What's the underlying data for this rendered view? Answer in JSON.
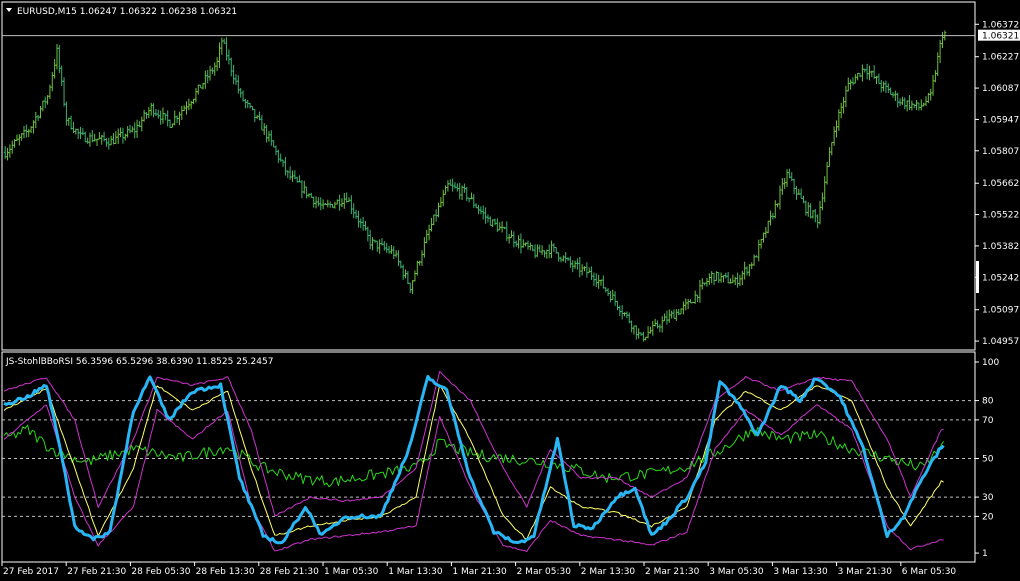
{
  "window": {
    "symbol_header": "EURUSD,M15  1.06247 1.06322 1.06238 1.06321",
    "indicator_header": "JS-StohlBBoRSI 56.3596 65.5296 38.6390 11.8525 25.2457"
  },
  "colors": {
    "background": "#000000",
    "axis": "#ffffff",
    "price_bars": "#3cb371",
    "price_bars_alt": "#6fbf3f",
    "rsi_line": "#2bd619",
    "main_line": "#29b6f6",
    "signal_line": "#ffff66",
    "band_lines": "#cc33cc",
    "level_lines": "#c0c0c0",
    "price_line": "#c0c0c0"
  },
  "chart_data": [
    {
      "type": "ohlc",
      "title": "EURUSD,M15",
      "ohlc_header": {
        "open": 1.06247,
        "high": 1.06322,
        "low": 1.06238,
        "close": 1.06321
      },
      "current_price_label": "1.06321",
      "ylim": [
        1.04935,
        1.064
      ],
      "y_ticks": [
        "1.06372",
        "1.06227",
        "1.06087",
        "1.05947",
        "1.05807",
        "1.05662",
        "1.05522",
        "1.05382",
        "1.05242",
        "1.05097",
        "1.04957"
      ],
      "x_ticks": [
        "27 Feb 2017",
        "27 Feb 21:30",
        "28 Feb 05:30",
        "28 Feb 13:30",
        "28 Feb 21:30",
        "1 Mar 05:30",
        "1 Mar 13:30",
        "1 Mar 21:30",
        "2 Mar 05:30",
        "2 Mar 13:30",
        "2 Mar 21:30",
        "3 Mar 05:30",
        "3 Mar 13:30",
        "3 Mar 21:30",
        "6 Mar 05:30"
      ],
      "close_anchors": [
        [
          0,
          1.058
        ],
        [
          10,
          1.059
        ],
        [
          18,
          1.0605
        ],
        [
          22,
          1.0625
        ],
        [
          26,
          1.0595
        ],
        [
          32,
          1.0587
        ],
        [
          45,
          1.0585
        ],
        [
          55,
          1.059
        ],
        [
          62,
          1.06
        ],
        [
          70,
          1.0593
        ],
        [
          80,
          1.0605
        ],
        [
          90,
          1.062
        ],
        [
          92,
          1.063
        ],
        [
          100,
          1.0605
        ],
        [
          110,
          1.059
        ],
        [
          120,
          1.057
        ],
        [
          135,
          1.0555
        ],
        [
          145,
          1.056
        ],
        [
          155,
          1.054
        ],
        [
          165,
          1.0535
        ],
        [
          172,
          1.052
        ],
        [
          180,
          1.0545
        ],
        [
          188,
          1.0565
        ],
        [
          195,
          1.0562
        ],
        [
          205,
          1.055
        ],
        [
          215,
          1.0542
        ],
        [
          225,
          1.0535
        ],
        [
          232,
          1.0537
        ],
        [
          240,
          1.053
        ],
        [
          250,
          1.0525
        ],
        [
          258,
          1.0515
        ],
        [
          265,
          1.0505
        ],
        [
          270,
          1.0497
        ],
        [
          280,
          1.0505
        ],
        [
          290,
          1.0512
        ],
        [
          300,
          1.0525
        ],
        [
          310,
          1.0522
        ],
        [
          318,
          1.0532
        ],
        [
          325,
          1.055
        ],
        [
          332,
          1.057
        ],
        [
          340,
          1.0555
        ],
        [
          345,
          1.055
        ],
        [
          352,
          1.059
        ],
        [
          358,
          1.061
        ],
        [
          365,
          1.0618
        ],
        [
          372,
          1.061
        ],
        [
          380,
          1.0603
        ],
        [
          388,
          1.06
        ],
        [
          393,
          1.0605
        ],
        [
          398,
          1.0633
        ]
      ]
    },
    {
      "type": "line",
      "title": "JS-StohlBBoRSI",
      "values_header": [
        56.3596,
        65.5296,
        38.639,
        11.8525,
        25.2457
      ],
      "ylim": [
        0,
        100
      ],
      "levels": [
        80,
        70,
        50,
        30,
        20
      ],
      "y_ticks": [
        "100",
        "80",
        "70",
        "50",
        "30",
        "20",
        "1"
      ],
      "series": [
        {
          "key": "rsi",
          "anchors": [
            [
              0,
              60
            ],
            [
              10,
              65
            ],
            [
              20,
              55
            ],
            [
              35,
              48
            ],
            [
              55,
              55
            ],
            [
              75,
              50
            ],
            [
              95,
              56
            ],
            [
              110,
              45
            ],
            [
              125,
              40
            ],
            [
              140,
              38
            ],
            [
              160,
              42
            ],
            [
              175,
              45
            ],
            [
              185,
              58
            ],
            [
              200,
              52
            ],
            [
              215,
              50
            ],
            [
              230,
              48
            ],
            [
              245,
              44
            ],
            [
              255,
              40
            ],
            [
              275,
              42
            ],
            [
              290,
              46
            ],
            [
              305,
              55
            ],
            [
              318,
              65
            ],
            [
              330,
              60
            ],
            [
              345,
              62
            ],
            [
              360,
              55
            ],
            [
              375,
              50
            ],
            [
              390,
              45
            ],
            [
              398,
              56
            ]
          ]
        },
        {
          "key": "main",
          "anchors": [
            [
              0,
              78
            ],
            [
              10,
              82
            ],
            [
              18,
              88
            ],
            [
              24,
              55
            ],
            [
              30,
              15
            ],
            [
              38,
              8
            ],
            [
              45,
              12
            ],
            [
              55,
              75
            ],
            [
              62,
              92
            ],
            [
              70,
              70
            ],
            [
              80,
              85
            ],
            [
              92,
              88
            ],
            [
              100,
              40
            ],
            [
              110,
              10
            ],
            [
              118,
              6
            ],
            [
              128,
              25
            ],
            [
              135,
              10
            ],
            [
              145,
              20
            ],
            [
              160,
              20
            ],
            [
              172,
              55
            ],
            [
              180,
              92
            ],
            [
              188,
              85
            ],
            [
              198,
              40
            ],
            [
              208,
              12
            ],
            [
              218,
              6
            ],
            [
              225,
              10
            ],
            [
              235,
              60
            ],
            [
              242,
              15
            ],
            [
              250,
              14
            ],
            [
              260,
              30
            ],
            [
              268,
              35
            ],
            [
              275,
              10
            ],
            [
              282,
              18
            ],
            [
              290,
              30
            ],
            [
              298,
              48
            ],
            [
              304,
              90
            ],
            [
              312,
              78
            ],
            [
              320,
              62
            ],
            [
              330,
              88
            ],
            [
              338,
              80
            ],
            [
              345,
              92
            ],
            [
              355,
              82
            ],
            [
              365,
              55
            ],
            [
              375,
              10
            ],
            [
              382,
              20
            ],
            [
              390,
              40
            ],
            [
              398,
              56
            ]
          ]
        },
        {
          "key": "signal",
          "anchors": [
            [
              0,
              75
            ],
            [
              18,
              86
            ],
            [
              30,
              45
            ],
            [
              40,
              10
            ],
            [
              55,
              45
            ],
            [
              65,
              88
            ],
            [
              80,
              75
            ],
            [
              95,
              85
            ],
            [
              105,
              45
            ],
            [
              115,
              10
            ],
            [
              130,
              15
            ],
            [
              145,
              18
            ],
            [
              160,
              20
            ],
            [
              175,
              30
            ],
            [
              185,
              88
            ],
            [
              198,
              60
            ],
            [
              212,
              20
            ],
            [
              222,
              8
            ],
            [
              232,
              35
            ],
            [
              245,
              25
            ],
            [
              260,
              22
            ],
            [
              275,
              15
            ],
            [
              290,
              25
            ],
            [
              302,
              70
            ],
            [
              315,
              85
            ],
            [
              330,
              75
            ],
            [
              345,
              88
            ],
            [
              360,
              80
            ],
            [
              375,
              35
            ],
            [
              385,
              15
            ],
            [
              398,
              38
            ]
          ]
        },
        {
          "key": "upper",
          "anchors": [
            [
              0,
              85
            ],
            [
              18,
              92
            ],
            [
              30,
              70
            ],
            [
              40,
              25
            ],
            [
              55,
              60
            ],
            [
              65,
              92
            ],
            [
              80,
              88
            ],
            [
              95,
              92
            ],
            [
              105,
              65
            ],
            [
              115,
              20
            ],
            [
              130,
              30
            ],
            [
              145,
              28
            ],
            [
              160,
              30
            ],
            [
              175,
              45
            ],
            [
              185,
              95
            ],
            [
              198,
              80
            ],
            [
              212,
              45
            ],
            [
              222,
              25
            ],
            [
              232,
              55
            ],
            [
              245,
              40
            ],
            [
              260,
              40
            ],
            [
              275,
              30
            ],
            [
              290,
              40
            ],
            [
              302,
              80
            ],
            [
              315,
              92
            ],
            [
              330,
              85
            ],
            [
              345,
              92
            ],
            [
              360,
              90
            ],
            [
              375,
              60
            ],
            [
              385,
              30
            ],
            [
              398,
              65
            ]
          ]
        },
        {
          "key": "lower",
          "anchors": [
            [
              0,
              60
            ],
            [
              18,
              78
            ],
            [
              30,
              30
            ],
            [
              40,
              5
            ],
            [
              55,
              25
            ],
            [
              65,
              75
            ],
            [
              80,
              60
            ],
            [
              95,
              75
            ],
            [
              105,
              25
            ],
            [
              115,
              2
            ],
            [
              130,
              8
            ],
            [
              145,
              10
            ],
            [
              160,
              12
            ],
            [
              175,
              15
            ],
            [
              185,
              72
            ],
            [
              198,
              35
            ],
            [
              212,
              5
            ],
            [
              222,
              2
            ],
            [
              232,
              18
            ],
            [
              245,
              10
            ],
            [
              260,
              8
            ],
            [
              275,
              5
            ],
            [
              290,
              12
            ],
            [
              302,
              55
            ],
            [
              315,
              75
            ],
            [
              330,
              62
            ],
            [
              345,
              78
            ],
            [
              360,
              65
            ],
            [
              375,
              15
            ],
            [
              385,
              3
            ],
            [
              398,
              8
            ]
          ]
        }
      ]
    }
  ]
}
